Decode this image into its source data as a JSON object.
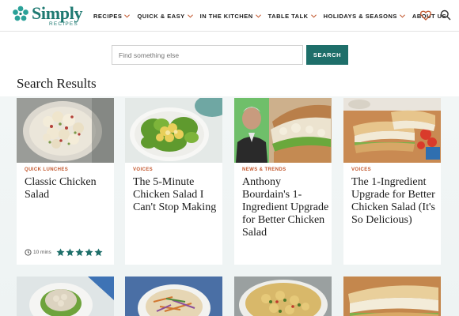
{
  "brand": {
    "name": "Simply",
    "sub": "RECIPES",
    "color": "#1f7a72"
  },
  "nav": {
    "items": [
      {
        "label": "RECIPES",
        "has_dropdown": true
      },
      {
        "label": "QUICK & EASY",
        "has_dropdown": true
      },
      {
        "label": "IN THE KITCHEN",
        "has_dropdown": true
      },
      {
        "label": "TABLE TALK",
        "has_dropdown": true
      },
      {
        "label": "HOLIDAYS & SEASONS",
        "has_dropdown": true
      },
      {
        "label": "ABOUT US",
        "has_dropdown": false
      }
    ],
    "icons": [
      "heart-icon",
      "search-icon"
    ]
  },
  "search": {
    "placeholder": "Find something else",
    "value": "",
    "button_label": "SEARCH",
    "button_color": "#1e6f6a"
  },
  "results": {
    "title": "Search Results",
    "cards": [
      {
        "tag": "QUICK LUNCHES",
        "title": "Classic Chicken Salad",
        "time": "10 mins",
        "rating": 5
      },
      {
        "tag": "VOICES",
        "title": "The 5-Minute Chicken Salad I Can't Stop Making"
      },
      {
        "tag": "NEWS & TRENDS",
        "title": "Anthony Bourdain's 1-Ingredient Upgrade for Better Chicken Salad"
      },
      {
        "tag": "VOICES",
        "title": "The 1-Ingredient Upgrade for Better Chicken Salad (It's So Delicious)"
      }
    ],
    "tag_color": "#c2552b",
    "star_color": "#1e6f6a"
  }
}
